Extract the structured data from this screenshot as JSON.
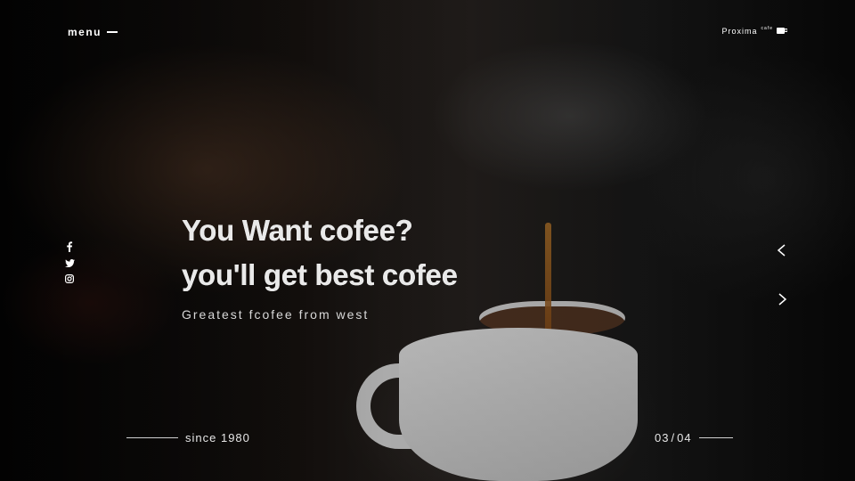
{
  "nav": {
    "menu_label": "menu",
    "brand_name": "Proxima",
    "brand_sup": "cafe",
    "brand_icon": "coffee-cup-icon"
  },
  "social": {
    "icons": [
      "facebook-icon",
      "twitter-icon",
      "instagram-icon"
    ]
  },
  "hero": {
    "headline_line1": "You Want cofee?",
    "headline_line2": "you'll get best cofee",
    "subtitle": "Greatest fcofee from west"
  },
  "controls": {
    "prev_icon": "chevron-left-icon",
    "next_icon": "chevron-right-icon"
  },
  "footer": {
    "since": "since 1980",
    "current_slide": "03",
    "separator": "/",
    "total_slides": "04"
  },
  "colors": {
    "text": "#ffffff",
    "coffee": "#c9822e",
    "background": "#0d0d0d"
  }
}
